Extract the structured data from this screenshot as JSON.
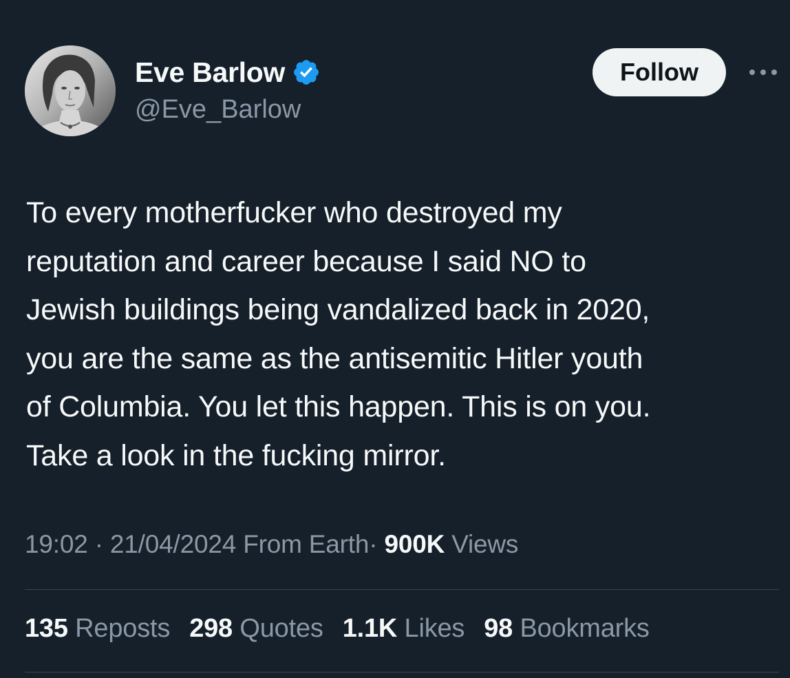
{
  "author": {
    "display_name": "Eve Barlow",
    "handle": "@Eve_Barlow",
    "verified": true
  },
  "follow_button": {
    "label": "Follow"
  },
  "tweet": {
    "text": "To every motherfucker who destroyed my\nreputation and career because I said NO to\nJewish buildings being vandalized back in 2020,\nyou are the same as the antisemitic Hitler youth\nof Columbia. You let this happen. This is on you.\nTake a look in the fucking mirror."
  },
  "meta": {
    "time": "19:02",
    "separator": "·",
    "date": "21/04/2024",
    "source": "From Earth",
    "views_count": "900K",
    "views_label": "Views"
  },
  "stats": {
    "reposts_count": "135",
    "reposts_label": "Reposts",
    "quotes_count": "298",
    "quotes_label": "Quotes",
    "likes_count": "1.1K",
    "likes_label": "Likes",
    "bookmarks_count": "98",
    "bookmarks_label": "Bookmarks"
  },
  "icons": {
    "verified": "verified-badge-icon",
    "more": "more-options-icon"
  },
  "colors": {
    "background": "#15202b",
    "text_primary": "#f7f9f9",
    "text_secondary": "#8b98a5",
    "verified_blue": "#1d9bf0",
    "follow_button_bg": "#eff3f4",
    "divider": "#38444d"
  }
}
